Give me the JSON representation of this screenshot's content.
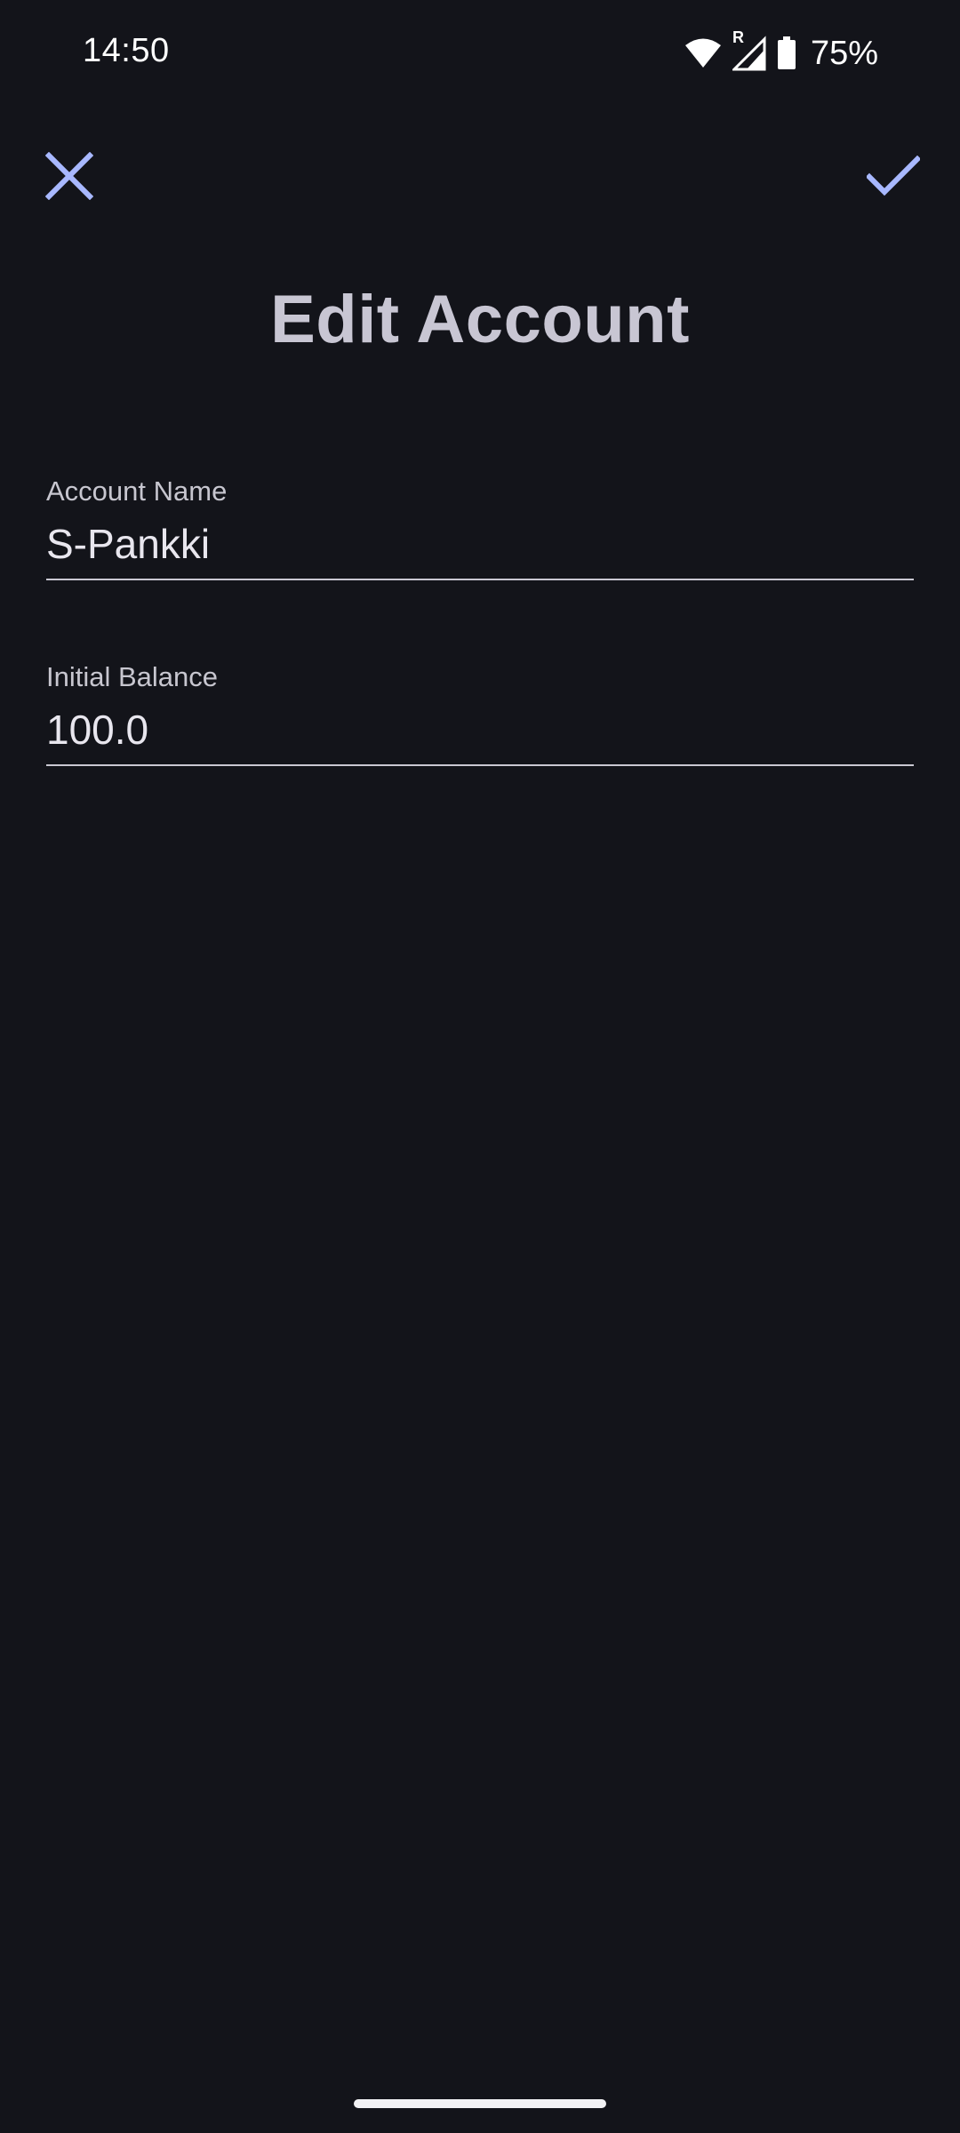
{
  "status_bar": {
    "time": "14:50",
    "roaming_indicator": "R",
    "battery_percent": "75%",
    "icons": [
      "wifi-icon",
      "cell-signal-icon",
      "battery-icon"
    ]
  },
  "toolbar": {
    "close_icon": "close-icon",
    "confirm_icon": "check-icon",
    "accent_color": "#a8b8ff"
  },
  "page": {
    "title": "Edit Account"
  },
  "form": {
    "account_name": {
      "label": "Account Name",
      "value": "S-Pankki"
    },
    "initial_balance": {
      "label": "Initial Balance",
      "value": "100.0"
    }
  },
  "colors": {
    "background": "#13141a",
    "title": "#c8c6d3",
    "text": "#e8e6ee",
    "underline": "#c9c8d2"
  }
}
